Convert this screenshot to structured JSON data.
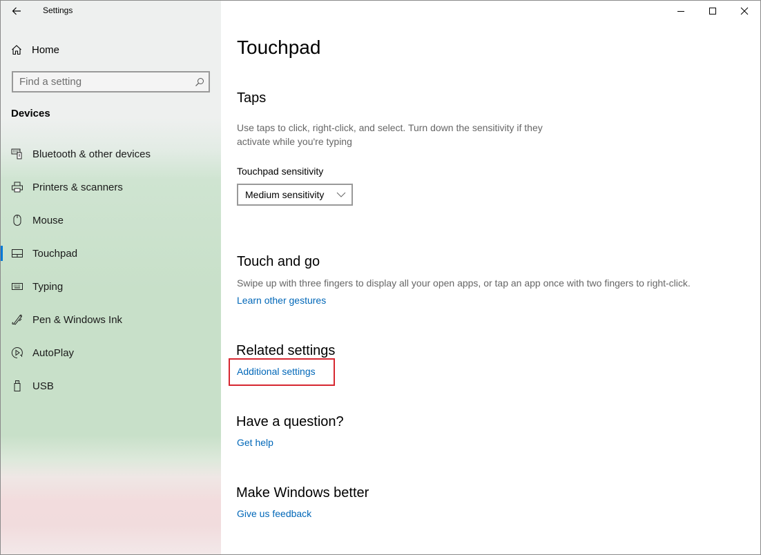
{
  "window": {
    "title": "Settings",
    "controls": {
      "minimize": "minimize",
      "maximize": "maximize",
      "close": "close"
    }
  },
  "sidebar": {
    "home_label": "Home",
    "search": {
      "placeholder": "Find a setting",
      "value": ""
    },
    "section_label": "Devices",
    "items": [
      {
        "label": "Bluetooth & other devices",
        "icon": "bluetooth-devices-icon",
        "selected": false
      },
      {
        "label": "Printers & scanners",
        "icon": "printer-icon",
        "selected": false
      },
      {
        "label": "Mouse",
        "icon": "mouse-icon",
        "selected": false
      },
      {
        "label": "Touchpad",
        "icon": "touchpad-icon",
        "selected": true
      },
      {
        "label": "Typing",
        "icon": "keyboard-icon",
        "selected": false
      },
      {
        "label": "Pen & Windows Ink",
        "icon": "pen-icon",
        "selected": false
      },
      {
        "label": "AutoPlay",
        "icon": "autoplay-icon",
        "selected": false
      },
      {
        "label": "USB",
        "icon": "usb-icon",
        "selected": false
      }
    ]
  },
  "main": {
    "page_title": "Touchpad",
    "taps": {
      "heading": "Taps",
      "description": "Use taps to click, right-click, and select. Turn down the sensitivity if they activate while you're typing",
      "sensitivity_label": "Touchpad sensitivity",
      "sensitivity_value": "Medium sensitivity"
    },
    "touch_and_go": {
      "heading": "Touch and go",
      "description": "Swipe up with three fingers to display all your open apps, or tap an app once with two fingers to right-click.",
      "link": "Learn other gestures"
    },
    "related": {
      "heading": "Related settings",
      "link": "Additional settings"
    },
    "question": {
      "heading": "Have a question?",
      "link": "Get help"
    },
    "feedback": {
      "heading": "Make Windows better",
      "link": "Give us feedback"
    }
  },
  "colors": {
    "accent": "#0078d7",
    "link": "#0067b8",
    "highlight": "#d6262f"
  }
}
